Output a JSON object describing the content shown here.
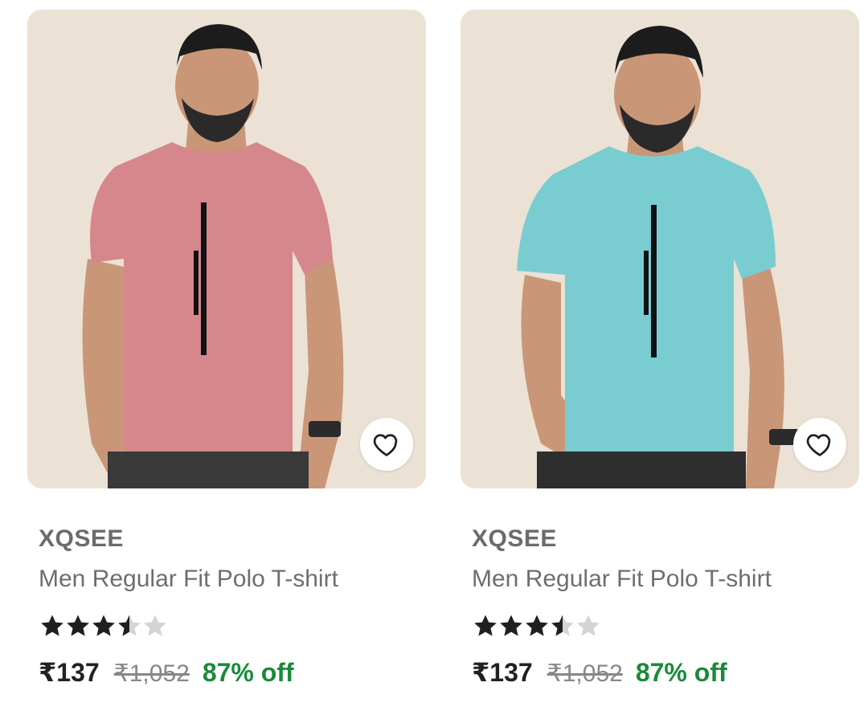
{
  "products": [
    {
      "brand": "XQSEE",
      "title": "Men Regular Fit Polo T-shirt",
      "rating_stars": 3.5,
      "price": "₹137",
      "mrp": "₹1,052",
      "discount": "87% off",
      "shirt_color": "#d6878b",
      "wishlist_icon": "heart-outline-icon"
    },
    {
      "brand": "XQSEE",
      "title": "Men Regular Fit Polo T-shirt",
      "rating_stars": 3.5,
      "price": "₹137",
      "mrp": "₹1,052",
      "discount": "87% off",
      "shirt_color": "#79cdd1",
      "wishlist_icon": "heart-outline-icon"
    }
  ],
  "colors": {
    "image_background": "#e8ddd1",
    "discount_green": "#1a8a3a",
    "star_filled": "#1f1f1f",
    "star_empty": "#d4d4d4"
  }
}
